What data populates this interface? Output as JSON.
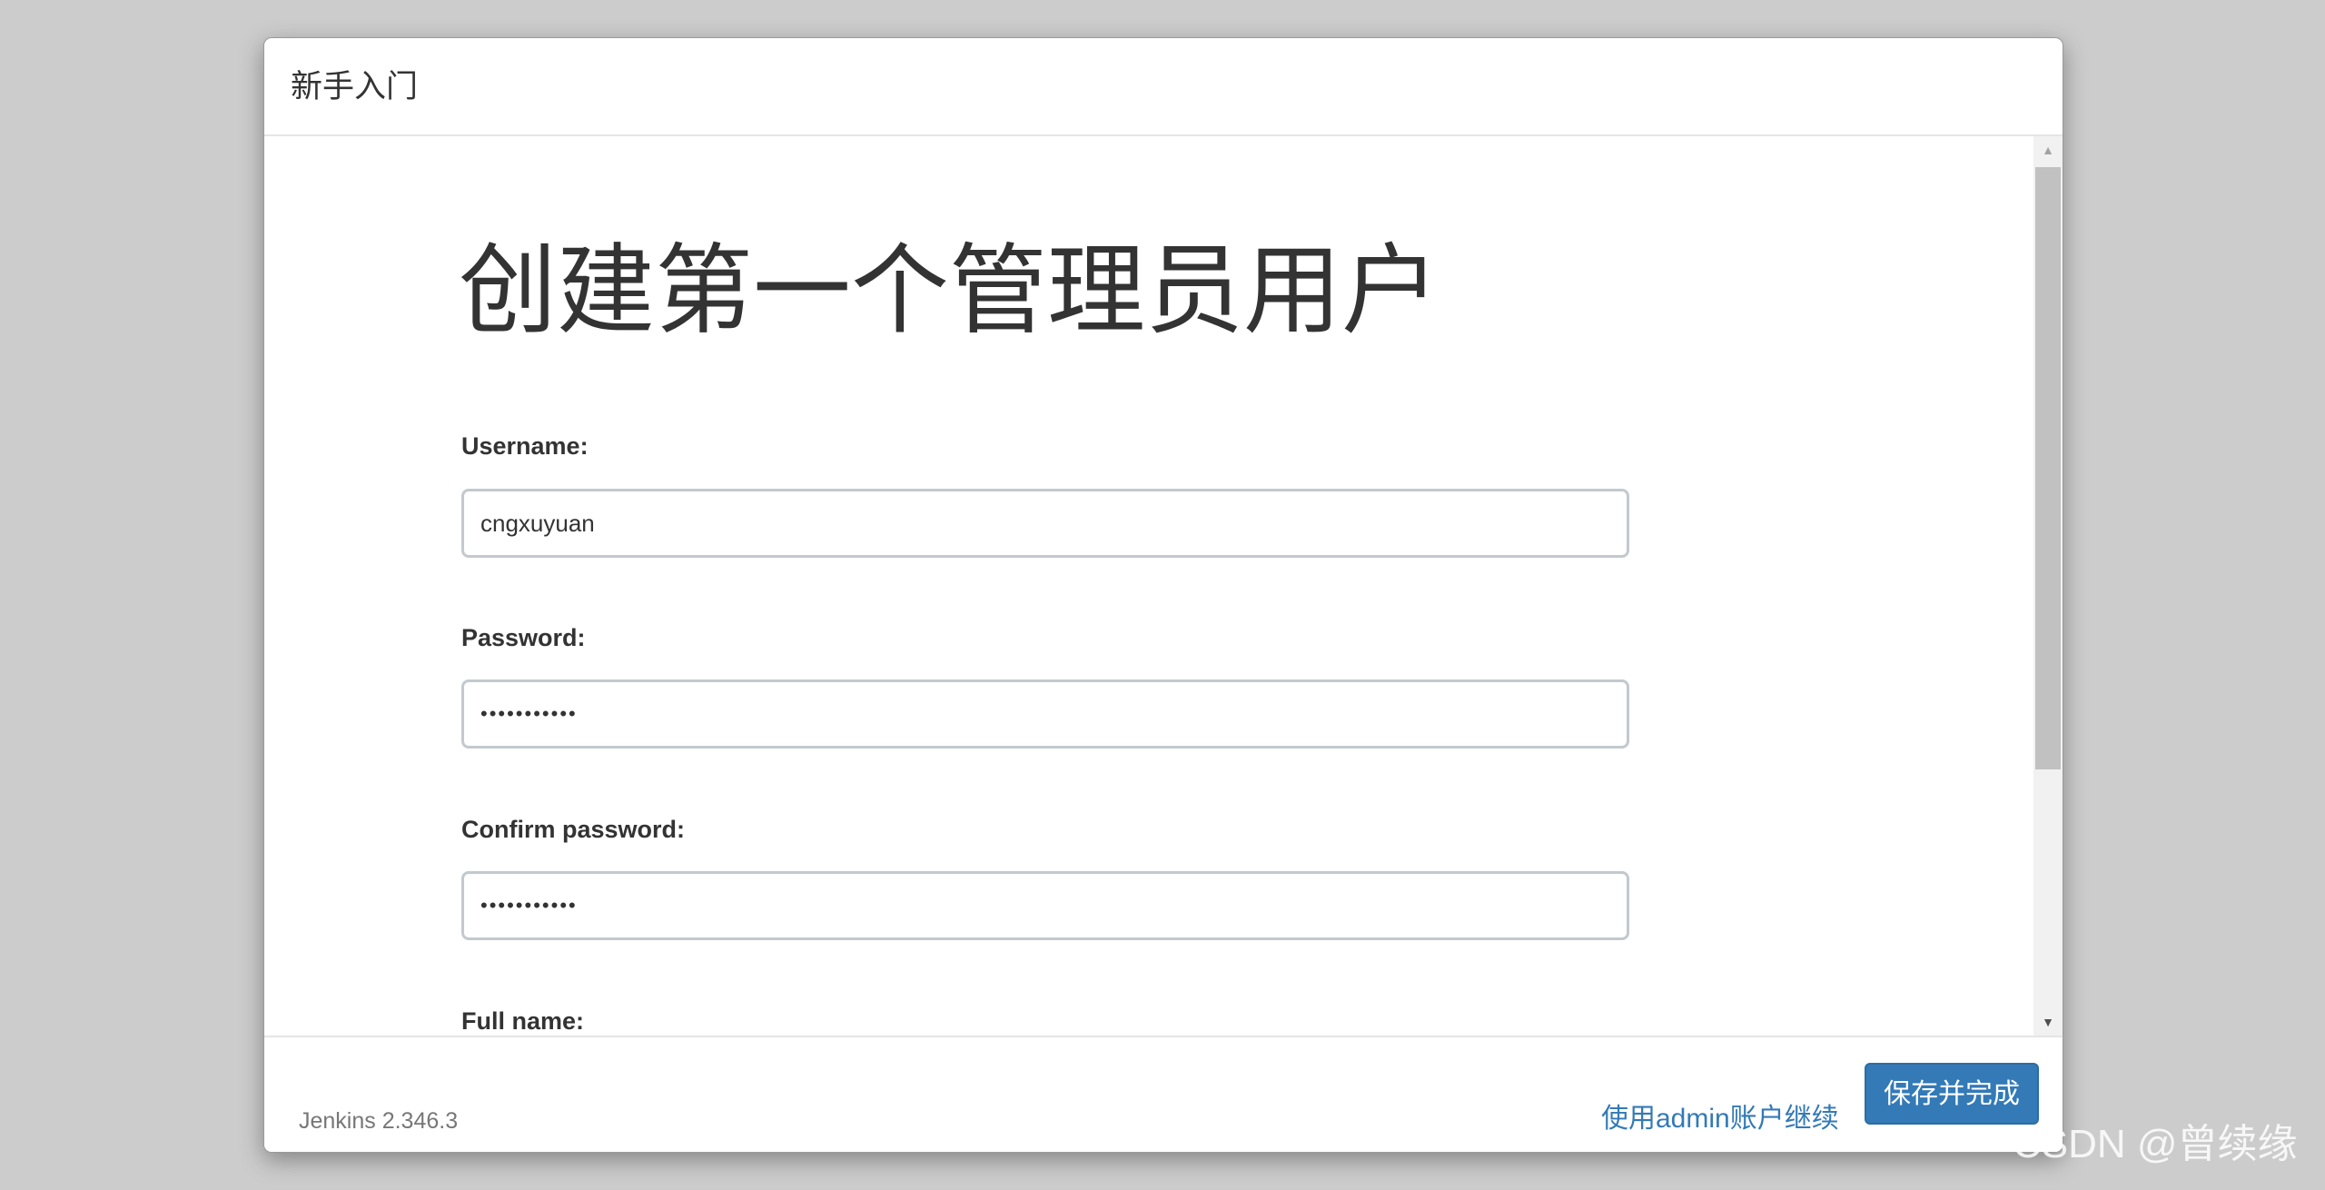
{
  "header": {
    "title": "新手入门"
  },
  "form": {
    "heading": "创建第一个管理员用户",
    "fields": {
      "username": {
        "label": "Username:",
        "value": "cngxuyuan"
      },
      "password": {
        "label": "Password:",
        "value": "•••••••••••"
      },
      "confirm_password": {
        "label": "Confirm password:",
        "value": "•••••••••••"
      },
      "full_name": {
        "label": "Full name:",
        "value": ""
      }
    }
  },
  "footer": {
    "version": "Jenkins 2.346.3",
    "continue_as_admin": "使用admin账户继续",
    "save_and_finish": "保存并完成"
  },
  "watermark": "CSDN @曾续缘",
  "colors": {
    "accent": "#337ab7",
    "page_background": "#cccccc"
  },
  "icons": {
    "scroll_up": "scroll-up-arrow-icon",
    "scroll_down": "scroll-down-arrow-icon"
  }
}
